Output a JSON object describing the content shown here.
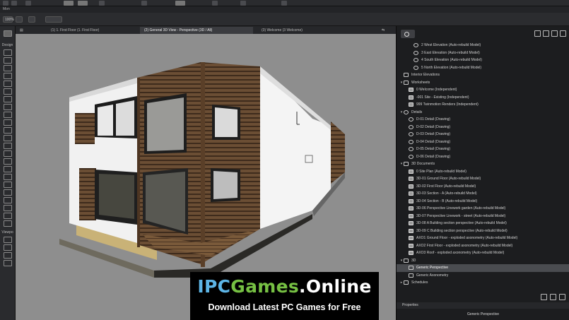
{
  "app": {
    "menu_label": "Mon",
    "zoom": "100%"
  },
  "tabs": [
    {
      "label": "(1) 1. First Floor (1. First Floor)"
    },
    {
      "label": "(2) General 3D View - Perspective (3D / All)"
    },
    {
      "label": "(3) Welcome (3 Welcome)"
    }
  ],
  "toolbox": {
    "design_label": "Design",
    "viewpoint_label": "Viewpo"
  },
  "navigator": {
    "items": [
      {
        "label": "2 West Elevation (Auto-rebuild Model)",
        "indent": 3,
        "icon": "elev-icon"
      },
      {
        "label": "3 East Elevation (Auto-rebuild Model)",
        "indent": 3,
        "icon": "elev-icon"
      },
      {
        "label": "4 South Elevation (Auto-rebuild Model)",
        "indent": 3,
        "icon": "elev-icon"
      },
      {
        "label": "5 North Elevation (Auto-rebuild Model)",
        "indent": 3,
        "icon": "elev-icon"
      },
      {
        "label": "Interior Elevations",
        "indent": 1,
        "icon": "folder-icon"
      },
      {
        "label": "Worksheets",
        "indent": 1,
        "icon": "folder-icon",
        "toggle": "▾"
      },
      {
        "label": "0 Welcome (Independent)",
        "indent": 2,
        "icon": "sheet-icon"
      },
      {
        "label": "-001 Site - Existing (Independent)",
        "indent": 2,
        "icon": "sheet-icon"
      },
      {
        "label": "999 Twinmotion Renders (Independent)",
        "indent": 2,
        "icon": "sheet-icon"
      },
      {
        "label": "Details",
        "indent": 1,
        "icon": "detail-icon",
        "toggle": "▾"
      },
      {
        "label": "D-01 Detail (Drawing)",
        "indent": 2,
        "icon": "detail-icon"
      },
      {
        "label": "D-02 Detail (Drawing)",
        "indent": 2,
        "icon": "detail-icon"
      },
      {
        "label": "D-03 Detail (Drawing)",
        "indent": 2,
        "icon": "detail-icon"
      },
      {
        "label": "D-04 Detail (Drawing)",
        "indent": 2,
        "icon": "detail-icon"
      },
      {
        "label": "D-05 Detail (Drawing)",
        "indent": 2,
        "icon": "detail-icon"
      },
      {
        "label": "D-06 Detail (Drawing)",
        "indent": 2,
        "icon": "detail-icon"
      },
      {
        "label": "3D Documents",
        "indent": 1,
        "icon": "folder-icon",
        "toggle": "▾"
      },
      {
        "label": "0 Site Plan (Auto-rebuild Model)",
        "indent": 2,
        "icon": "doc3d-icon"
      },
      {
        "label": "3D-01 Ground Floor (Auto-rebuild Model)",
        "indent": 2,
        "icon": "doc3d-icon"
      },
      {
        "label": "3D-02 First Floor (Auto-rebuild Model)",
        "indent": 2,
        "icon": "doc3d-icon"
      },
      {
        "label": "3D-03 Section - A (Auto-rebuild Model)",
        "indent": 2,
        "icon": "doc3d-icon"
      },
      {
        "label": "3D-04 Section - B (Auto-rebuild Model)",
        "indent": 2,
        "icon": "doc3d-icon"
      },
      {
        "label": "3D-06 Perspective Linework garden (Auto-rebuild Model)",
        "indent": 2,
        "icon": "doc3d-icon"
      },
      {
        "label": "3D-07 Perspective Linework - street (Auto-rebuild Model)",
        "indent": 2,
        "icon": "doc3d-icon"
      },
      {
        "label": "3D-08 A Building section perspective (Auto-rebuild Model)",
        "indent": 2,
        "icon": "doc3d-icon"
      },
      {
        "label": "3D-09 C Building section perspective (Auto-rebuild Model)",
        "indent": 2,
        "icon": "doc3d-icon"
      },
      {
        "label": "AXO1 Ground Floor - exploded axonometry (Auto-rebuild Model)",
        "indent": 2,
        "icon": "doc3d-icon"
      },
      {
        "label": "AXO2 First Floor - exploded axonometry (Auto-rebuild Model)",
        "indent": 2,
        "icon": "doc3d-icon"
      },
      {
        "label": "AXO3 Roof - exploded axonometry (Auto-rebuild Model)",
        "indent": 2,
        "icon": "doc3d-icon"
      },
      {
        "label": "3D",
        "indent": 1,
        "icon": "cube-icon",
        "toggle": "▾"
      },
      {
        "label": "Generic Perspective",
        "indent": 2,
        "icon": "cube-icon",
        "selected": true
      },
      {
        "label": "Generic Axonometry",
        "indent": 2,
        "icon": "cube-icon"
      },
      {
        "label": "Schedules",
        "indent": 1,
        "icon": "folder-icon",
        "toggle": "▸"
      }
    ]
  },
  "properties": {
    "header": "Properties",
    "value": "Generic Perspective"
  },
  "banner": {
    "title_part1": "IPC",
    "title_part2": "Games",
    "title_part3": ".Online",
    "subtitle": "Download Latest PC Games for Free"
  }
}
